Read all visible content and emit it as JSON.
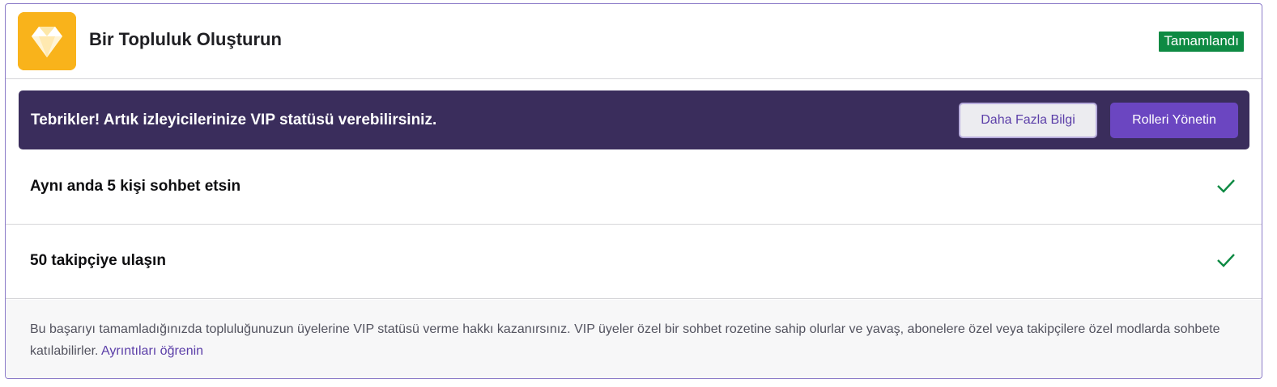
{
  "achievement": {
    "icon": "diamond-icon",
    "title": "Bir Topluluk Oluşturun",
    "status": "Tamamlandı",
    "colors": {
      "status_green": "#0e8a43",
      "icon_bg": "#fbbc1e",
      "banner_bg": "#3a2d5c",
      "accent": "#6b46c1"
    }
  },
  "banner": {
    "message": "Tebrikler! Artık izleyicilerinize VIP statüsü verebilirsiniz.",
    "learn_more_label": "Daha Fazla Bilgi",
    "manage_roles_label": "Rolleri Yönetin"
  },
  "requirements": [
    {
      "label": "Aynı anda 5 kişi sohbet etsin",
      "icon": "checkmark-icon",
      "completed": true
    },
    {
      "label": "50 takipçiye ulaşın",
      "icon": "checkmark-icon",
      "completed": true
    }
  ],
  "footer": {
    "description": "Bu başarıyı tamamladığınızda topluluğunuzun üyelerine VIP statüsü verme hakkı kazanırsınız. VIP üyeler özel bir sohbet rozetine sahip olurlar ve yavaş, abonelere özel veya takipçilere özel modlarda sohbete katılabilirler.",
    "link_label": "Ayrıntıları öğrenin"
  }
}
